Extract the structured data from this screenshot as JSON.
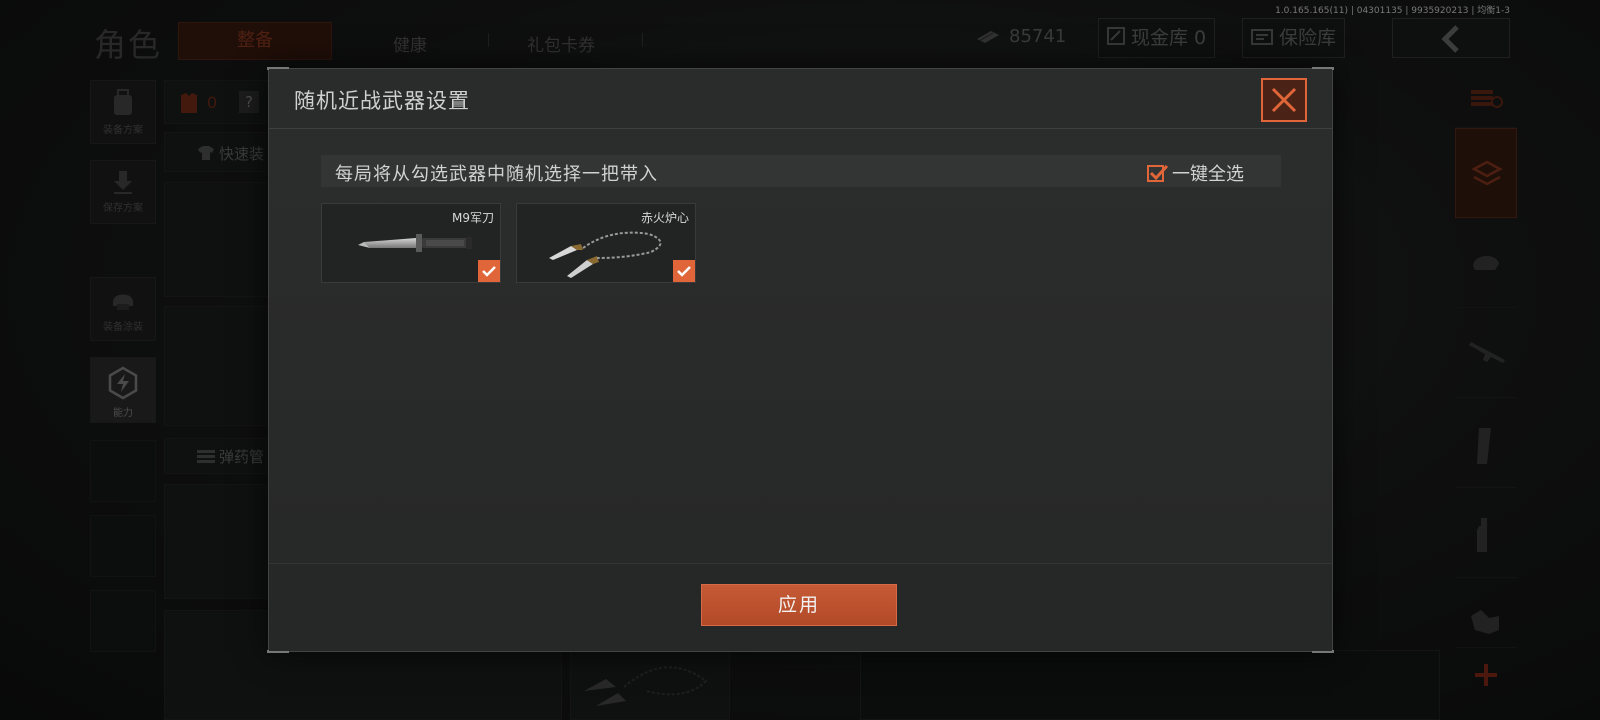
{
  "version_info": "1.0.165.165(11) | 04301135 | 9935920213 | 均衡1-3",
  "header": {
    "page_title": "角色",
    "tabs": [
      {
        "label": "整备",
        "active": true
      },
      {
        "label": "健康",
        "active": false
      },
      {
        "label": "礼包卡券",
        "active": false
      }
    ],
    "currency": "85741",
    "cash_vault_label": "现金库 0",
    "insurance_label": "保险库"
  },
  "left_panel": {
    "items": [
      {
        "label": "装备方案"
      },
      {
        "label": "保存方案"
      },
      {
        "label": "装备涂装"
      },
      {
        "label": "能力"
      }
    ],
    "armor_count": "0",
    "help_icon": "?",
    "quick_equip_label": "快速装",
    "ammo_label": "弹药管"
  },
  "modal": {
    "title": "随机近战武器设置",
    "hint": "每局将从勾选武器中随机选择一把带入",
    "select_all_label": "一键全选",
    "select_all_checked": true,
    "weapons": [
      {
        "name": "M9军刀",
        "checked": true,
        "icon": "knife-icon"
      },
      {
        "name": "赤火炉心",
        "checked": true,
        "icon": "chain-blade-icon"
      }
    ],
    "apply_label": "应用"
  },
  "colors": {
    "accent": "#e0663a",
    "accent_dark": "#b24a28",
    "modal_bg": "#2b2c2c"
  }
}
